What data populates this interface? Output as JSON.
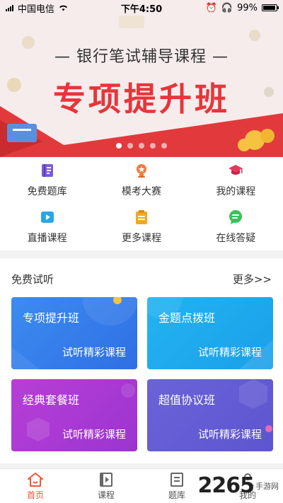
{
  "status_bar": {
    "carrier": "中国电信",
    "time": "下午4:50",
    "battery": "99%",
    "battery_level": 0.99
  },
  "banner": {
    "subtitle": "— 银行笔试辅导课程 —",
    "title": "专项提升班",
    "slide_count": 5,
    "active_slide": 0
  },
  "menu": [
    {
      "label": "免费题库",
      "icon": "question-bank-icon",
      "color": "#7b5bd6"
    },
    {
      "label": "模考大赛",
      "icon": "trophy-icon",
      "color": "#f27a3a"
    },
    {
      "label": "我的课程",
      "icon": "graduation-cap-icon",
      "color": "#e8365c"
    },
    {
      "label": "直播课程",
      "icon": "live-play-icon",
      "color": "#2aa6e6"
    },
    {
      "label": "更多课程",
      "icon": "clipboard-icon",
      "color": "#f5a623"
    },
    {
      "label": "在线答疑",
      "icon": "chat-icon",
      "color": "#3cc15b"
    }
  ],
  "trial": {
    "heading": "免费试听",
    "more": "更多>>",
    "cards": [
      {
        "title": "专项提升班",
        "subtitle": "试听精彩课程"
      },
      {
        "title": "金题点拨班",
        "subtitle": "试听精彩课程"
      },
      {
        "title": "经典套餐班",
        "subtitle": "试听精彩课程"
      },
      {
        "title": "超值协议班",
        "subtitle": "试听精彩课程"
      }
    ]
  },
  "tabbar": {
    "tabs": [
      {
        "label": "首页",
        "icon": "home-icon",
        "active": true
      },
      {
        "label": "课程",
        "icon": "course-play-icon",
        "active": false
      },
      {
        "label": "题库",
        "icon": "question-bank-icon",
        "active": false
      },
      {
        "label": "我的",
        "icon": "user-icon",
        "active": false
      }
    ]
  },
  "watermark": {
    "number": "2265",
    "text": "手游网"
  },
  "colors": {
    "accent": "#f0563c",
    "banner_red": "#e5363b"
  }
}
